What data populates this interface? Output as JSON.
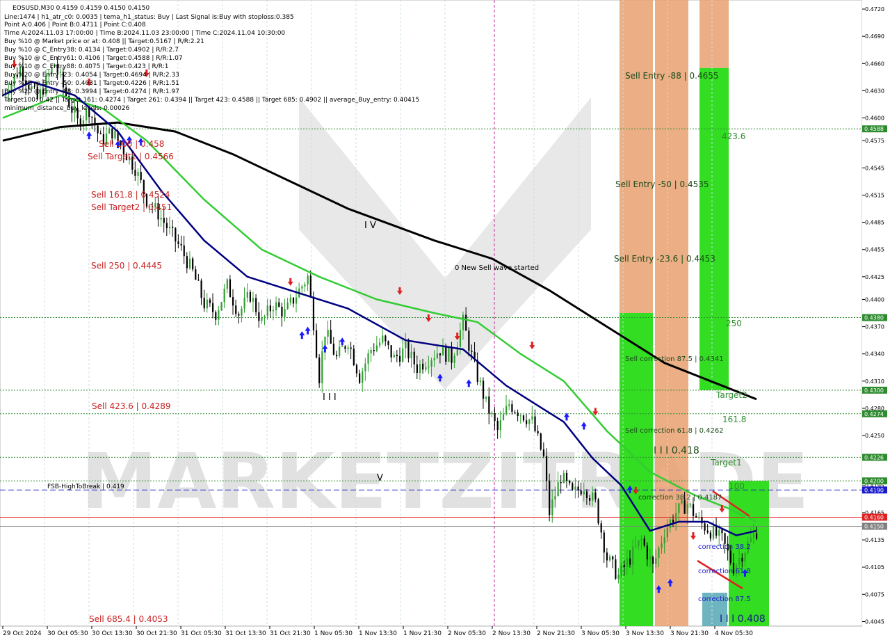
{
  "header": {
    "lines": [
      "EOSUSD,M30  0.4159 0.4159 0.4150 0.4150",
      "Line:1474 | h1_atr_c0: 0.0035 | tema_h1_status: Buy | Last Signal is:Buy with stoploss:0.385",
      "Point A:0.406 | Point B:0.4711 | Point C:0.408",
      "Time A:2024.11.03 17:00:00 | Time B:2024.11.03 23:00:00 | Time C:2024.11.04 10:30:00",
      "Buy %10 @ Market price or at: 0.408 || Target:0.5167 | R/R:2.21",
      "Buy %10 @ C_Entry38: 0.4134 | Target:0.4902 | R/R:2.7",
      "Buy %10 @ C_Entry61: 0.4106 | Target:0.4588 | R/R:1.07",
      "Buy %10 @ C_Entry88: 0.4075 | Target:0.423 | R/R:1",
      "Buy %20 @ Entry -23: 0.4054 | Target:0.4694 | R/R:2.33",
      "Buy %20 @ Entry -50: 0.4031 | Target:0.4226 | R/R:1.51",
      "Buy %20 @ Entry -88: 0.3994 | Target:0.4274 | R/R:1.97",
      "Target100: 0.42 || Target 161: 0.4274 | Target 261: 0.4394 || Target 423: 0.4588 || Target 685: 0.4902 || average_Buy_entry: 0.40415",
      "minimum_distance_buy_levels: 0.00026"
    ]
  },
  "watermark": "MARKETZITRADE",
  "price_levels": [
    {
      "price": 0.4588,
      "label": "0.4588",
      "color": "#2e8b2e",
      "style": "dotted"
    },
    {
      "price": 0.438,
      "label": "0.4380",
      "color": "#2e8b2e",
      "style": "dotted"
    },
    {
      "price": 0.43,
      "label": "0.4300",
      "color": "#2e8b2e",
      "style": "dotted"
    },
    {
      "price": 0.4274,
      "label": "0.4274",
      "color": "#2e8b2e",
      "style": "dotted"
    },
    {
      "price": 0.4226,
      "label": "0.4226",
      "color": "#2e8b2e",
      "style": "dotted"
    },
    {
      "price": 0.42,
      "label": "0.4200",
      "color": "#2e8b2e",
      "style": "dotted"
    },
    {
      "price": 0.419,
      "label": "0.4190",
      "color": "#1a1acd",
      "style": "dashed"
    },
    {
      "price": 0.416,
      "label": "0.4160",
      "color": "#e02020",
      "style": "solid"
    },
    {
      "price": 0.415,
      "label": "0.4150",
      "color": "#808080",
      "style": "solid"
    }
  ],
  "annotations": {
    "sell_100": "Sell 100 | 0.458",
    "sell_target1": "Sell Target1 | 0.4566",
    "sell_161": "Sell 161.8 | 0.4524",
    "sell_target2": "Sell Target2 | 0.451",
    "sell_250": "Sell  250 | 0.4445",
    "sell_423": "Sell  423.6 | 0.4289",
    "sell_685": "Sell  685.4 | 0.4053",
    "fsb": "FSB-HighToBreak  | 0.419",
    "wave_iv": "I V",
    "wave_iii": "I I I",
    "wave_v": "V",
    "new_wave": "0 New Sell wave started",
    "sell_entry_88": "Sell Entry -88 | 0.4655",
    "sell_entry_50": "Sell Entry -50 | 0.4535",
    "sell_entry_23": "Sell Entry -23.6 | 0.4453",
    "sell_corr_87": "Sell correction 87.5 | 0.4341",
    "sell_corr_61": "Sell correction 61.8 | 0.4262",
    "sell_corr_38": "correction 38.2 | 0.4187",
    "wave_418": "I I I 0.418",
    "wave_408": "I I I 0.408",
    "fib_423": "423.6",
    "fib_250": "250",
    "fib_161": "161.8",
    "fib_100": "100",
    "target2": "Target2",
    "target1": "Target1",
    "corr_38": "correction 38.2",
    "corr_61": "correction 61.8",
    "corr_87": "correction 87.5"
  },
  "colors": {
    "ma_black": "#000000",
    "ma_green": "#33cc33",
    "ma_navy": "#000080",
    "band_orange": "#ff6a00",
    "bull_candle": "#2ea02e",
    "bear_candle": "#000000",
    "zone_green": "#33dd22",
    "zone_orange": "#e8a070",
    "buy_arrow": "#1a1aff",
    "sell_arrow": "#e02020"
  },
  "chart_data": {
    "type": "candlestick",
    "symbol": "EOSUSD",
    "timeframe": "M30",
    "ylim": [
      0.404,
      0.473
    ],
    "y_ticks": [
      0.472,
      0.469,
      0.466,
      0.463,
      0.46,
      0.4575,
      0.4545,
      0.4515,
      0.4485,
      0.4455,
      0.4425,
      0.44,
      0.437,
      0.434,
      0.431,
      0.428,
      0.425,
      0.4195,
      0.4165,
      0.4135,
      0.4105,
      0.4075,
      0.4045
    ],
    "x_tick_labels": [
      "29 Oct 2024",
      "30 Oct 05:30",
      "30 Oct 13:30",
      "30 Oct 21:30",
      "31 Oct 05:30",
      "31 Oct 13:30",
      "31 Oct 21:30",
      "1 Nov 05:30",
      "1 Nov 13:30",
      "1 Nov 21:30",
      "2 Nov 05:30",
      "2 Nov 13:30",
      "2 Nov 21:30",
      "3 Nov 05:30",
      "3 Nov 13:30",
      "3 Nov 21:30",
      "4 Nov 05:30"
    ],
    "close_path": [
      [
        0,
        0.4625
      ],
      [
        6,
        0.4655
      ],
      [
        12,
        0.462
      ],
      [
        18,
        0.466
      ],
      [
        22,
        0.4625
      ],
      [
        26,
        0.4595
      ],
      [
        30,
        0.461
      ],
      [
        34,
        0.4575
      ],
      [
        38,
        0.4585
      ],
      [
        42,
        0.4565
      ],
      [
        46,
        0.4545
      ],
      [
        50,
        0.451
      ],
      [
        54,
        0.4495
      ],
      [
        58,
        0.4475
      ],
      [
        62,
        0.4455
      ],
      [
        66,
        0.443
      ],
      [
        70,
        0.4395
      ],
      [
        74,
        0.4385
      ],
      [
        78,
        0.4415
      ],
      [
        82,
        0.4385
      ],
      [
        86,
        0.4405
      ],
      [
        90,
        0.4375
      ],
      [
        94,
        0.4395
      ],
      [
        98,
        0.4385
      ],
      [
        102,
        0.4405
      ],
      [
        106,
        0.4425
      ],
      [
        108,
        0.4375
      ],
      [
        110,
        0.4315
      ],
      [
        112,
        0.4365
      ],
      [
        116,
        0.4335
      ],
      [
        120,
        0.4355
      ],
      [
        124,
        0.4315
      ],
      [
        128,
        0.4345
      ],
      [
        132,
        0.4355
      ],
      [
        136,
        0.4335
      ],
      [
        140,
        0.4345
      ],
      [
        144,
        0.4325
      ],
      [
        148,
        0.4335
      ],
      [
        152,
        0.4345
      ],
      [
        156,
        0.4335
      ],
      [
        160,
        0.4375
      ],
      [
        164,
        0.4325
      ],
      [
        168,
        0.4285
      ],
      [
        172,
        0.4255
      ],
      [
        176,
        0.4285
      ],
      [
        180,
        0.4275
      ],
      [
        184,
        0.4265
      ],
      [
        188,
        0.4225
      ],
      [
        190,
        0.4165
      ],
      [
        194,
        0.4205
      ],
      [
        198,
        0.4185
      ],
      [
        202,
        0.4195
      ],
      [
        206,
        0.4175
      ],
      [
        210,
        0.4115
      ],
      [
        214,
        0.4095
      ],
      [
        218,
        0.4115
      ],
      [
        222,
        0.4135
      ],
      [
        226,
        0.4105
      ],
      [
        230,
        0.4145
      ],
      [
        234,
        0.4165
      ],
      [
        238,
        0.4175
      ],
      [
        242,
        0.4155
      ],
      [
        246,
        0.4145
      ],
      [
        250,
        0.4135
      ],
      [
        254,
        0.4105
      ],
      [
        258,
        0.4125
      ],
      [
        262,
        0.4145
      ]
    ],
    "series": [
      {
        "name": "MA slow (black)",
        "values": [
          [
            0,
            0.4575
          ],
          [
            20,
            0.459
          ],
          [
            40,
            0.4595
          ],
          [
            60,
            0.4585
          ],
          [
            80,
            0.456
          ],
          [
            100,
            0.453
          ],
          [
            120,
            0.45
          ],
          [
            150,
            0.4465
          ],
          [
            170,
            0.4445
          ],
          [
            190,
            0.441
          ],
          [
            210,
            0.437
          ],
          [
            230,
            0.433
          ],
          [
            250,
            0.4305
          ],
          [
            262,
            0.429
          ]
        ]
      },
      {
        "name": "MA mid (green)",
        "values": [
          [
            0,
            0.46
          ],
          [
            20,
            0.4625
          ],
          [
            35,
            0.461
          ],
          [
            50,
            0.4575
          ],
          [
            70,
            0.451
          ],
          [
            90,
            0.4455
          ],
          [
            110,
            0.4425
          ],
          [
            130,
            0.44
          ],
          [
            150,
            0.4385
          ],
          [
            165,
            0.4375
          ],
          [
            180,
            0.434
          ],
          [
            195,
            0.431
          ],
          [
            210,
            0.4255
          ],
          [
            225,
            0.421
          ],
          [
            240,
            0.4185
          ],
          [
            252,
            0.417
          ],
          [
            262,
            0.4155
          ]
        ]
      },
      {
        "name": "MA fast (navy)",
        "values": [
          [
            0,
            0.4625
          ],
          [
            10,
            0.464
          ],
          [
            25,
            0.4625
          ],
          [
            40,
            0.4585
          ],
          [
            55,
            0.452
          ],
          [
            70,
            0.4465
          ],
          [
            85,
            0.4425
          ],
          [
            100,
            0.441
          ],
          [
            120,
            0.439
          ],
          [
            140,
            0.4355
          ],
          [
            160,
            0.4345
          ],
          [
            175,
            0.4305
          ],
          [
            185,
            0.4285
          ],
          [
            195,
            0.4265
          ],
          [
            205,
            0.4225
          ],
          [
            215,
            0.4195
          ],
          [
            225,
            0.4145
          ],
          [
            235,
            0.4155
          ],
          [
            245,
            0.4155
          ],
          [
            255,
            0.414
          ],
          [
            262,
            0.4145
          ]
        ]
      }
    ]
  }
}
